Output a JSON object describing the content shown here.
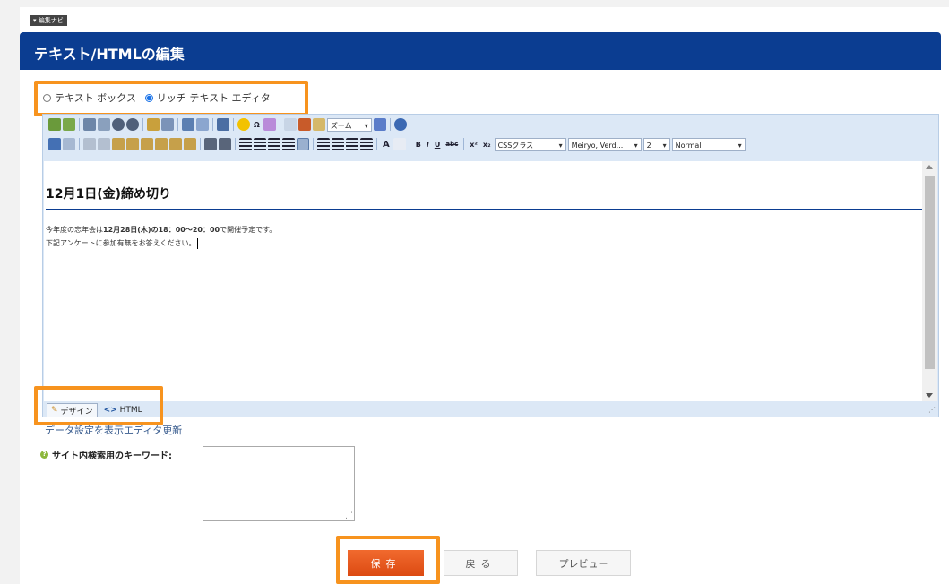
{
  "nav_tab": "▾ 編集ナビ",
  "header": {
    "title": "テキスト/HTMLの編集"
  },
  "mode": {
    "textbox_label": "テキスト ボックス",
    "richtext_label": "リッチ テキスト エディタ",
    "selected": "richtext"
  },
  "toolbar": {
    "zoom_label": "ズーム",
    "css_class": "CSSクラス",
    "font_family": "Meiryo, Verd...",
    "font_size": "2",
    "format": "Normal",
    "bold_label": "B",
    "italic_label": "I",
    "underline_label": "U",
    "strike_label": "abc",
    "super_label": "x²",
    "sub_label": "x₂",
    "font_color_label": "A",
    "omega_label": "Ω"
  },
  "content": {
    "heading": "12月1日(金)締め切り",
    "line1_pre": "今年度の忘年会は",
    "line1_bold": "12月28日(木)の18：00〜20：00",
    "line1_post": "で開催予定です。",
    "line2": "下記アンケートに参加有無をお答えください。"
  },
  "editor_tabs": {
    "design": "デザイン",
    "html": "HTML"
  },
  "update_link": "データ設定を表示エディタ更新",
  "keyword": {
    "label": "サイト内検索用のキーワード:",
    "value": ""
  },
  "buttons": {
    "save": "保存",
    "back": "戻る",
    "preview": "プレビュー"
  },
  "colors": {
    "header_bg": "#0b3d91",
    "highlight": "#f7931e",
    "save_bg": "#e85a1e"
  }
}
